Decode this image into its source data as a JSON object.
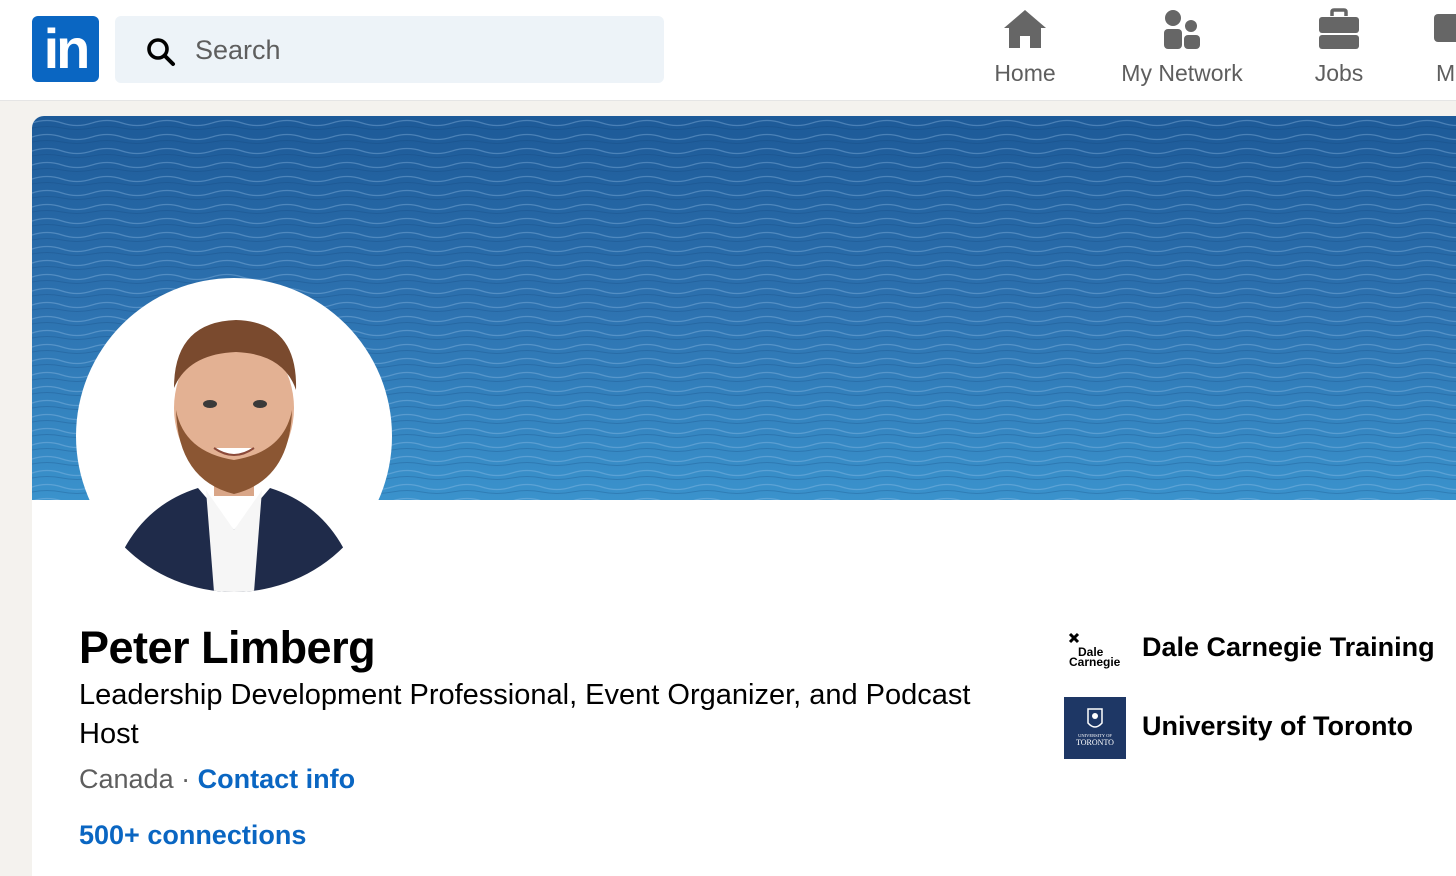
{
  "nav": {
    "logo_text": "in",
    "search": {
      "placeholder": "Search"
    },
    "items": [
      {
        "label": "Home",
        "icon": "home-icon"
      },
      {
        "label": "My Network",
        "icon": "network-icon"
      },
      {
        "label": "Jobs",
        "icon": "briefcase-icon"
      },
      {
        "label": "M",
        "icon": "messaging-icon"
      }
    ]
  },
  "profile": {
    "name": "Peter Limberg",
    "headline": "Leadership Development Professional, Event Organizer, and Podcast Host",
    "location": "Canada",
    "separator": " · ",
    "contact_label": "Contact info",
    "connections": "500+ connections",
    "organizations": [
      {
        "name": "Dale Carnegie Training",
        "logo_text": "Dale Carnegie"
      },
      {
        "name": "University of Toronto",
        "logo_text": "UNIVERSITY OF TORONTO"
      }
    ]
  },
  "colors": {
    "brand": "#0a66c2",
    "banner": "#2f74ad",
    "background": "#f4f2ee"
  }
}
